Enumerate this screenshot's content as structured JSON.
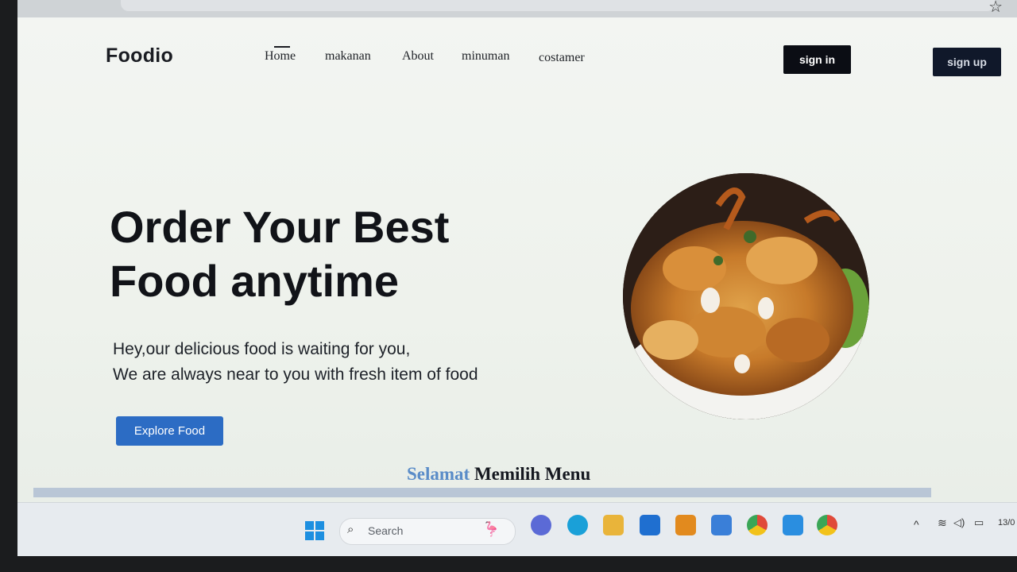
{
  "nav": {
    "logo": "Foodio",
    "items": [
      {
        "label": "Home"
      },
      {
        "label": "makanan"
      },
      {
        "label": "About"
      },
      {
        "label": "minuman"
      },
      {
        "label": "costamer"
      }
    ],
    "sign_in": "sign in",
    "sign_up": "sign up"
  },
  "hero": {
    "title_line1": "Order Your Best",
    "title_line2": "Food anytime",
    "subtitle_line1": "Hey,our delicious food is waiting for you,",
    "subtitle_line2": "We are always near to you with fresh item of food",
    "cta": "Explore Food"
  },
  "section": {
    "heading_part1": "Selamat",
    "heading_part2": "Memilih Menu"
  },
  "taskbar": {
    "search_placeholder": "Search",
    "clock": "13/0"
  },
  "colors": {
    "accent": "#2c6cc4",
    "dark_button": "#0b0d14"
  }
}
